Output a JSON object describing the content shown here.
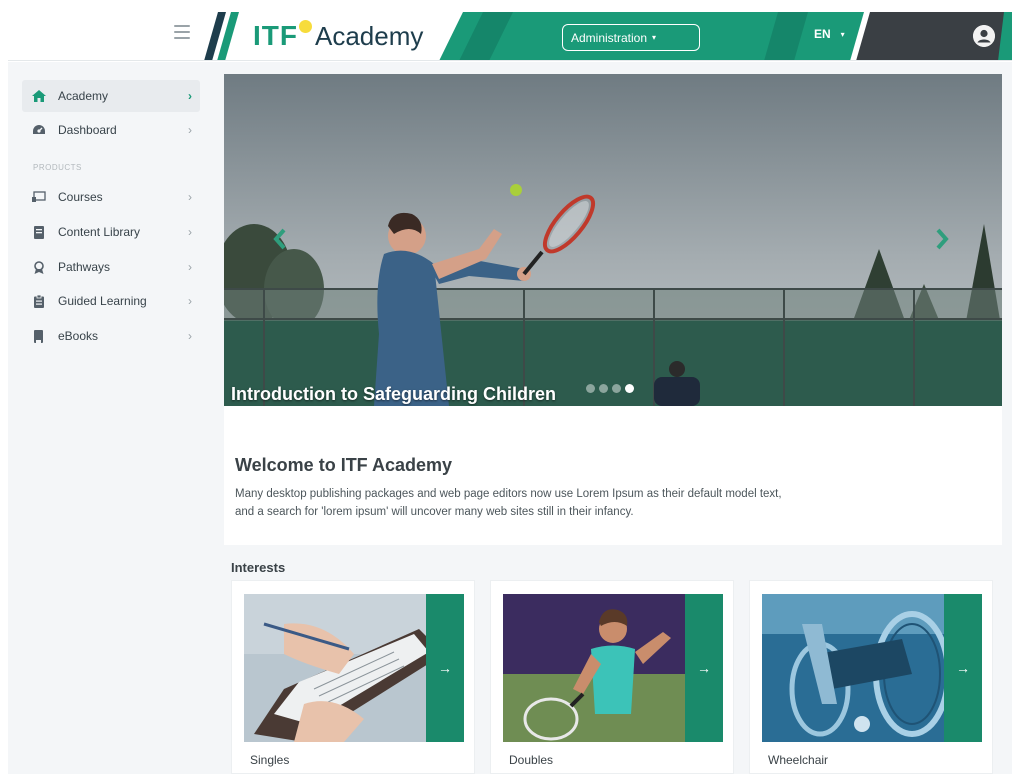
{
  "header": {
    "logo_mark": "ITF",
    "logo_word": "Academy",
    "admin_label": "Administration",
    "lang_label": "EN",
    "colors": {
      "brand_green": "#1a9a78",
      "brand_dark": "#3a3f44",
      "logo_ball": "#f7dc3c"
    }
  },
  "sidebar": {
    "section_products": "PRODUCTS",
    "items": [
      {
        "label": "Academy",
        "icon": "home-icon",
        "active": true
      },
      {
        "label": "Dashboard",
        "icon": "gauge-icon"
      },
      {
        "label": "Courses",
        "icon": "presentation-icon"
      },
      {
        "label": "Content Library",
        "icon": "book-icon"
      },
      {
        "label": "Pathways",
        "icon": "award-icon"
      },
      {
        "label": "Guided Learning",
        "icon": "clipboard-icon"
      },
      {
        "label": "eBooks",
        "icon": "ebook-icon"
      }
    ]
  },
  "hero": {
    "caption": "Introduction to Safeguarding Children",
    "slide_count": 4,
    "active_slide": 4
  },
  "welcome": {
    "title": "Welcome to ITF Academy",
    "text": "Many desktop publishing packages and web page editors now use Lorem Ipsum as their default model text, and a search for 'lorem ipsum' will uncover many web sites still in their infancy."
  },
  "interests": {
    "title": "Interests",
    "cards": [
      {
        "label": "Singles"
      },
      {
        "label": "Doubles"
      },
      {
        "label": "Wheelchair"
      }
    ]
  }
}
